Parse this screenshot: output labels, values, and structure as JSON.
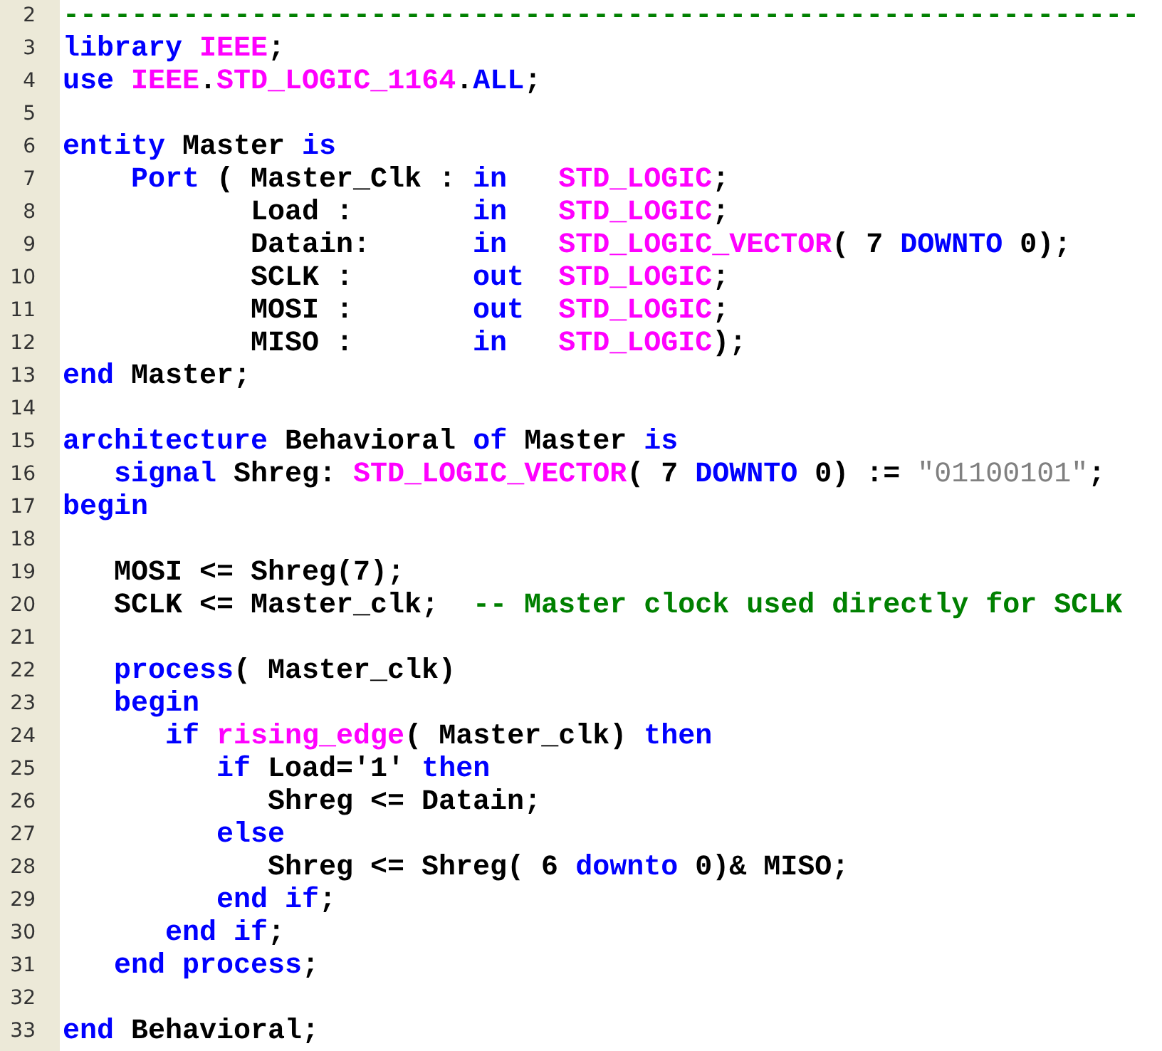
{
  "editor": {
    "lines": [
      {
        "number": "2",
        "tokens": [
          {
            "kind": "comment",
            "text": "---------------------------------------------------------------"
          }
        ]
      },
      {
        "number": "3",
        "tokens": [
          {
            "kind": "keyword",
            "text": "library "
          },
          {
            "kind": "type",
            "text": "IEEE"
          },
          {
            "kind": "plain",
            "text": ";"
          }
        ]
      },
      {
        "number": "4",
        "tokens": [
          {
            "kind": "keyword",
            "text": "use "
          },
          {
            "kind": "type",
            "text": "IEEE"
          },
          {
            "kind": "plain",
            "text": "."
          },
          {
            "kind": "type",
            "text": "STD_LOGIC_1164"
          },
          {
            "kind": "plain",
            "text": "."
          },
          {
            "kind": "keyword",
            "text": "ALL"
          },
          {
            "kind": "plain",
            "text": ";"
          }
        ]
      },
      {
        "number": "5"
      },
      {
        "number": "6",
        "tokens": [
          {
            "kind": "keyword",
            "text": "entity"
          },
          {
            "kind": "plain",
            "text": " Master "
          },
          {
            "kind": "keyword",
            "text": "is"
          }
        ]
      },
      {
        "number": "7",
        "tokens": [
          {
            "kind": "keyword",
            "text": "    Port"
          },
          {
            "kind": "plain",
            "text": " ( Master_Clk : "
          },
          {
            "kind": "keyword",
            "text": "in   "
          },
          {
            "kind": "type",
            "text": "STD_LOGIC"
          },
          {
            "kind": "plain",
            "text": ";"
          }
        ]
      },
      {
        "number": "8",
        "tokens": [
          {
            "kind": "plain",
            "text": "           Load :       "
          },
          {
            "kind": "keyword",
            "text": "in   "
          },
          {
            "kind": "type",
            "text": "STD_LOGIC"
          },
          {
            "kind": "plain",
            "text": ";"
          }
        ]
      },
      {
        "number": "9",
        "tokens": [
          {
            "kind": "plain",
            "text": "           Datain:      "
          },
          {
            "kind": "keyword",
            "text": "in   "
          },
          {
            "kind": "type",
            "text": "STD_LOGIC_VECTOR"
          },
          {
            "kind": "plain",
            "text": "( 7 "
          },
          {
            "kind": "keyword",
            "text": "DOWNTO"
          },
          {
            "kind": "plain",
            "text": " 0);"
          }
        ]
      },
      {
        "number": "10",
        "tokens": [
          {
            "kind": "plain",
            "text": "           SCLK :       "
          },
          {
            "kind": "keyword",
            "text": "out  "
          },
          {
            "kind": "type",
            "text": "STD_LOGIC"
          },
          {
            "kind": "plain",
            "text": ";"
          }
        ]
      },
      {
        "number": "11",
        "tokens": [
          {
            "kind": "plain",
            "text": "           MOSI :       "
          },
          {
            "kind": "keyword",
            "text": "out  "
          },
          {
            "kind": "type",
            "text": "STD_LOGIC"
          },
          {
            "kind": "plain",
            "text": ";"
          }
        ]
      },
      {
        "number": "12",
        "tokens": [
          {
            "kind": "plain",
            "text": "           MISO :       "
          },
          {
            "kind": "keyword",
            "text": "in   "
          },
          {
            "kind": "type",
            "text": "STD_LOGIC"
          },
          {
            "kind": "plain",
            "text": ");"
          }
        ]
      },
      {
        "number": "13",
        "tokens": [
          {
            "kind": "keyword",
            "text": "end"
          },
          {
            "kind": "plain",
            "text": " Master;"
          }
        ]
      },
      {
        "number": "14"
      },
      {
        "number": "15",
        "tokens": [
          {
            "kind": "keyword",
            "text": "architecture"
          },
          {
            "kind": "plain",
            "text": " Behavioral "
          },
          {
            "kind": "keyword",
            "text": "of"
          },
          {
            "kind": "plain",
            "text": " Master "
          },
          {
            "kind": "keyword",
            "text": "is"
          }
        ]
      },
      {
        "number": "16",
        "tokens": [
          {
            "kind": "keyword",
            "text": "   signal"
          },
          {
            "kind": "plain",
            "text": " Shreg: "
          },
          {
            "kind": "type",
            "text": "STD_LOGIC_VECTOR"
          },
          {
            "kind": "plain",
            "text": "( 7 "
          },
          {
            "kind": "keyword",
            "text": "DOWNTO"
          },
          {
            "kind": "plain",
            "text": " 0) := "
          },
          {
            "kind": "string",
            "text": "\"01100101\""
          },
          {
            "kind": "plain",
            "text": ";"
          }
        ]
      },
      {
        "number": "17",
        "tokens": [
          {
            "kind": "keyword",
            "text": "begin"
          }
        ]
      },
      {
        "number": "18"
      },
      {
        "number": "19",
        "tokens": [
          {
            "kind": "plain",
            "text": "   MOSI <= Shreg(7);"
          }
        ]
      },
      {
        "number": "20",
        "tokens": [
          {
            "kind": "plain",
            "text": "   SCLK <= Master_clk;  "
          },
          {
            "kind": "comment",
            "text": "-- Master clock used directly for SCLK"
          }
        ]
      },
      {
        "number": "21"
      },
      {
        "number": "22",
        "tokens": [
          {
            "kind": "keyword",
            "text": "   process"
          },
          {
            "kind": "plain",
            "text": "( Master_clk)"
          }
        ]
      },
      {
        "number": "23",
        "tokens": [
          {
            "kind": "keyword",
            "text": "   begin"
          }
        ]
      },
      {
        "number": "24",
        "tokens": [
          {
            "kind": "keyword",
            "text": "      if "
          },
          {
            "kind": "type",
            "text": "rising_edge"
          },
          {
            "kind": "plain",
            "text": "( Master_clk) "
          },
          {
            "kind": "keyword",
            "text": "then"
          }
        ]
      },
      {
        "number": "25",
        "tokens": [
          {
            "kind": "keyword",
            "text": "         if"
          },
          {
            "kind": "plain",
            "text": " Load='1' "
          },
          {
            "kind": "keyword",
            "text": "then"
          }
        ]
      },
      {
        "number": "26",
        "tokens": [
          {
            "kind": "plain",
            "text": "            Shreg <= Datain;"
          }
        ]
      },
      {
        "number": "27",
        "tokens": [
          {
            "kind": "keyword",
            "text": "         else"
          }
        ]
      },
      {
        "number": "28",
        "tokens": [
          {
            "kind": "plain",
            "text": "            Shreg <= Shreg( 6 "
          },
          {
            "kind": "keyword",
            "text": "downto"
          },
          {
            "kind": "plain",
            "text": " 0)& MISO;"
          }
        ]
      },
      {
        "number": "29",
        "tokens": [
          {
            "kind": "keyword",
            "text": "         end if"
          },
          {
            "kind": "plain",
            "text": ";"
          }
        ]
      },
      {
        "number": "30",
        "tokens": [
          {
            "kind": "keyword",
            "text": "      end if"
          },
          {
            "kind": "plain",
            "text": ";"
          }
        ]
      },
      {
        "number": "31",
        "tokens": [
          {
            "kind": "keyword",
            "text": "   end process"
          },
          {
            "kind": "plain",
            "text": ";"
          }
        ]
      },
      {
        "number": "32"
      },
      {
        "number": "33",
        "tokens": [
          {
            "kind": "keyword",
            "text": "end"
          },
          {
            "kind": "plain",
            "text": " Behavioral;"
          }
        ]
      }
    ]
  }
}
